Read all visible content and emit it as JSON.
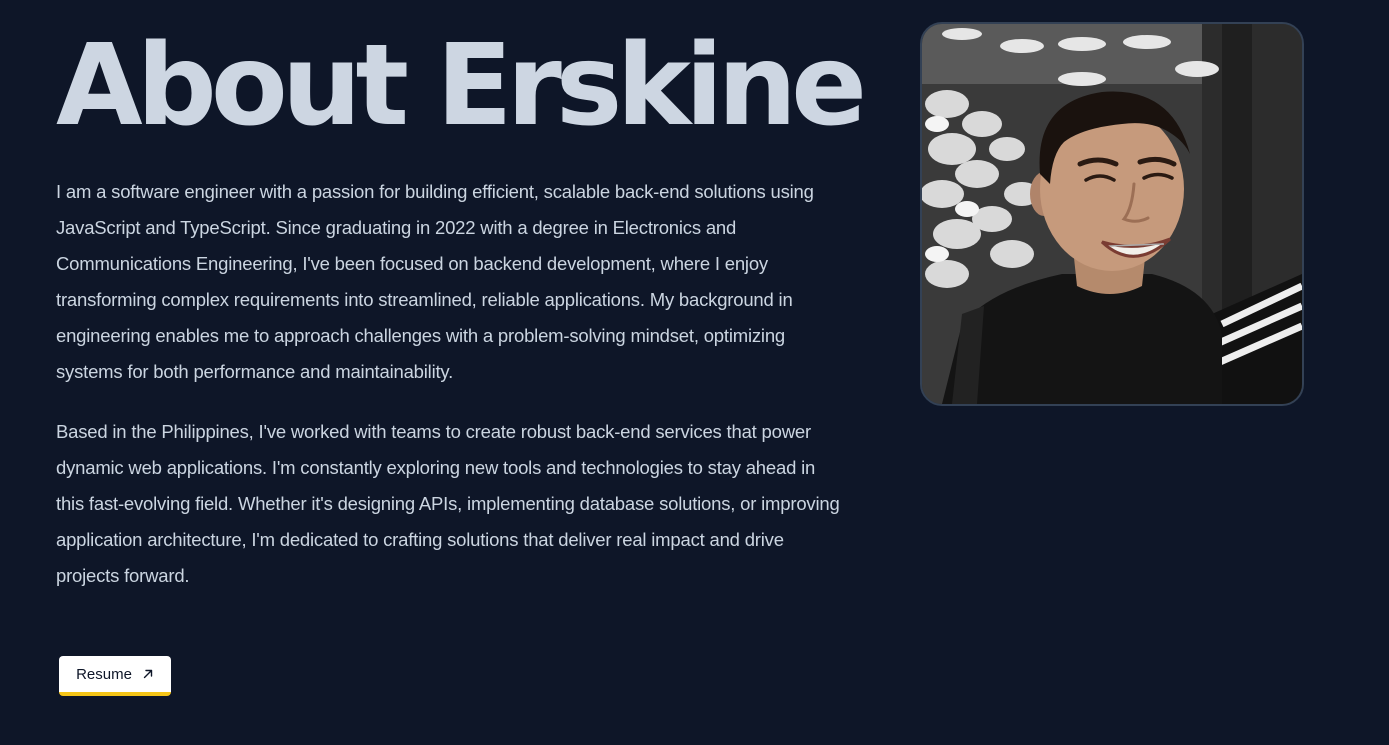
{
  "about": {
    "title": "About Erskine",
    "paragraphs": [
      "I am a software engineer with a passion for building efficient, scalable back-end solutions using JavaScript and TypeScript. Since graduating in 2022 with a degree in Electronics and Communications Engineering, I've been focused on backend development, where I enjoy transforming complex requirements into streamlined, reliable applications. My background in engineering enables me to approach challenges with a problem-solving mindset, optimizing systems for both performance and maintainability.",
      "Based in the Philippines, I've worked with teams to create robust back-end services that power dynamic web applications. I'm constantly exploring new tools and technologies to stay ahead in this fast-evolving field. Whether it's designing APIs, implementing database solutions, or improving application architecture, I'm dedicated to crafting solutions that deliver real impact and drive projects forward."
    ],
    "resume_button": {
      "label": "Resume",
      "icon": "arrow-up-right-icon"
    },
    "portrait": {
      "alt": "Erskine"
    }
  },
  "colors": {
    "background": "#0e1628",
    "title": "#cdd6e2",
    "body_text": "#cbd5e1",
    "button_background": "#ffffff",
    "button_accent": "#f5c518",
    "portrait_border": "#334155"
  }
}
